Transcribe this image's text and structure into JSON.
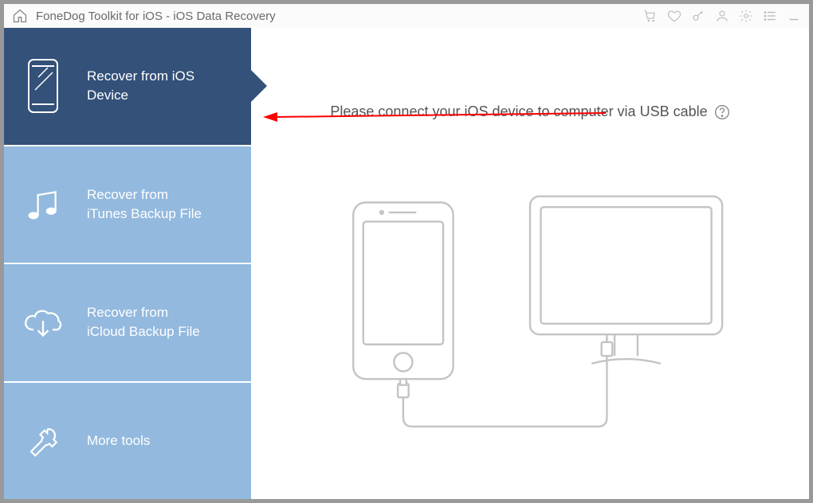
{
  "app_title": "FoneDog Toolkit for iOS - iOS Data Recovery",
  "sidebar": {
    "items": [
      {
        "label": "Recover from iOS Device",
        "icon": "phone-icon",
        "active": true
      },
      {
        "label": "Recover from iTunes Backup File",
        "icon": "music-icon",
        "active": false
      },
      {
        "label": "Recover from iCloud Backup File",
        "icon": "cloud-download-icon",
        "active": false
      },
      {
        "label": "More tools",
        "icon": "wrench-icon",
        "active": false
      }
    ]
  },
  "main": {
    "instruction": "Please connect your iOS device to computer via USB cable"
  }
}
